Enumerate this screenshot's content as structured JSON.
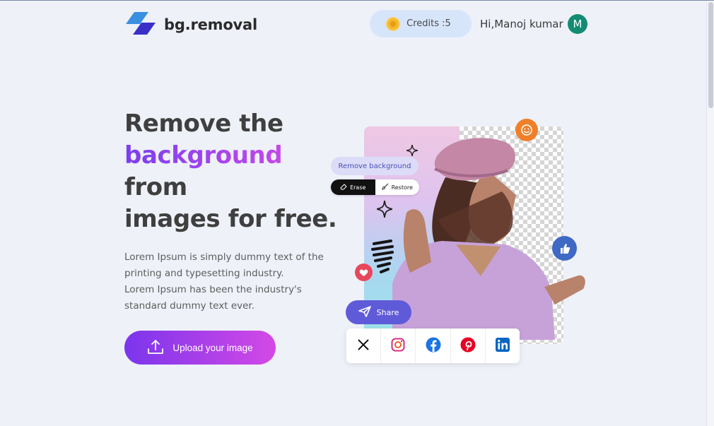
{
  "header": {
    "logo_text": "bg.removal",
    "credits_label": "Credits :5",
    "greeting": "Hi,Manoj kumar",
    "avatar_initial": "M"
  },
  "hero": {
    "title_line1": "Remove the",
    "title_accent": "background",
    "title_line3": "from",
    "title_line4": "images for free.",
    "description_line1": "Lorem Ipsum is simply dummy text of the",
    "description_line2": "printing and typesetting industry.",
    "description_line3": "Lorem Ipsum has been the industry's",
    "description_line4": "standard dummy text ever.",
    "upload_label": "Upload your image"
  },
  "preview": {
    "remove_bg_label": "Remove background",
    "erase_label": "Erase",
    "restore_label": "Restore",
    "share_label": "Share",
    "social_icons": [
      "x-icon",
      "instagram-icon",
      "facebook-icon",
      "pinterest-icon",
      "linkedin-icon"
    ]
  },
  "colors": {
    "accent_start": "#7b35ec",
    "accent_end": "#d449e6",
    "credits_bg": "#d7e5fb",
    "avatar_bg": "#128c73",
    "share_bg": "#5f5bd8"
  }
}
